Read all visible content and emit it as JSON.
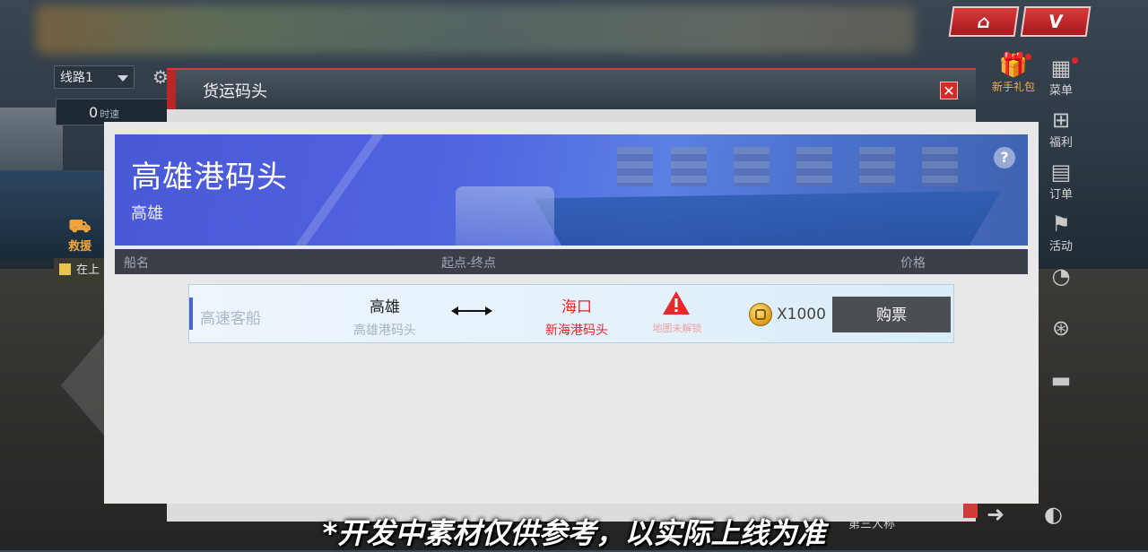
{
  "hud": {
    "route_select": "线路1",
    "speed_value": "0",
    "speed_unit": "时速",
    "rescue_label": "救援",
    "task_label": "在上",
    "view_label": "第三人称"
  },
  "top_buttons": [
    {
      "icon": "shop-icon"
    },
    {
      "icon": "vip-icon",
      "label": "V"
    }
  ],
  "gift": {
    "label": "新手礼包",
    "icon": "gift-box-icon"
  },
  "right_menu": [
    {
      "label": "菜单",
      "icon": "grid-icon"
    },
    {
      "label": "福利",
      "icon": "gift-icon"
    },
    {
      "label": "订单",
      "icon": "clipboard-icon"
    },
    {
      "label": "活动",
      "icon": "flag-icon"
    }
  ],
  "dialog": {
    "title": "货运码头",
    "close": "✕",
    "banner": {
      "title": "高雄港码头",
      "subtitle": "高雄",
      "help": "?"
    },
    "columns": {
      "ship": "船名",
      "route": "起点-终点",
      "price": "价格"
    },
    "rows": [
      {
        "ship_name": "高速客船",
        "from_city": "高雄",
        "from_port": "高雄港码头",
        "to_city": "海口",
        "to_port": "新海港码头",
        "warning": "地图未解锁",
        "price": "X1000",
        "buy_label": "购票"
      }
    ]
  },
  "subtitle": "*开发中素材仅供参考，以实际上线为准",
  "colors": {
    "accent_red": "#d23a3a",
    "banner_blue": "#4f63e0",
    "destination_red": "#e3262c",
    "buy_button": "#4b4f54"
  }
}
